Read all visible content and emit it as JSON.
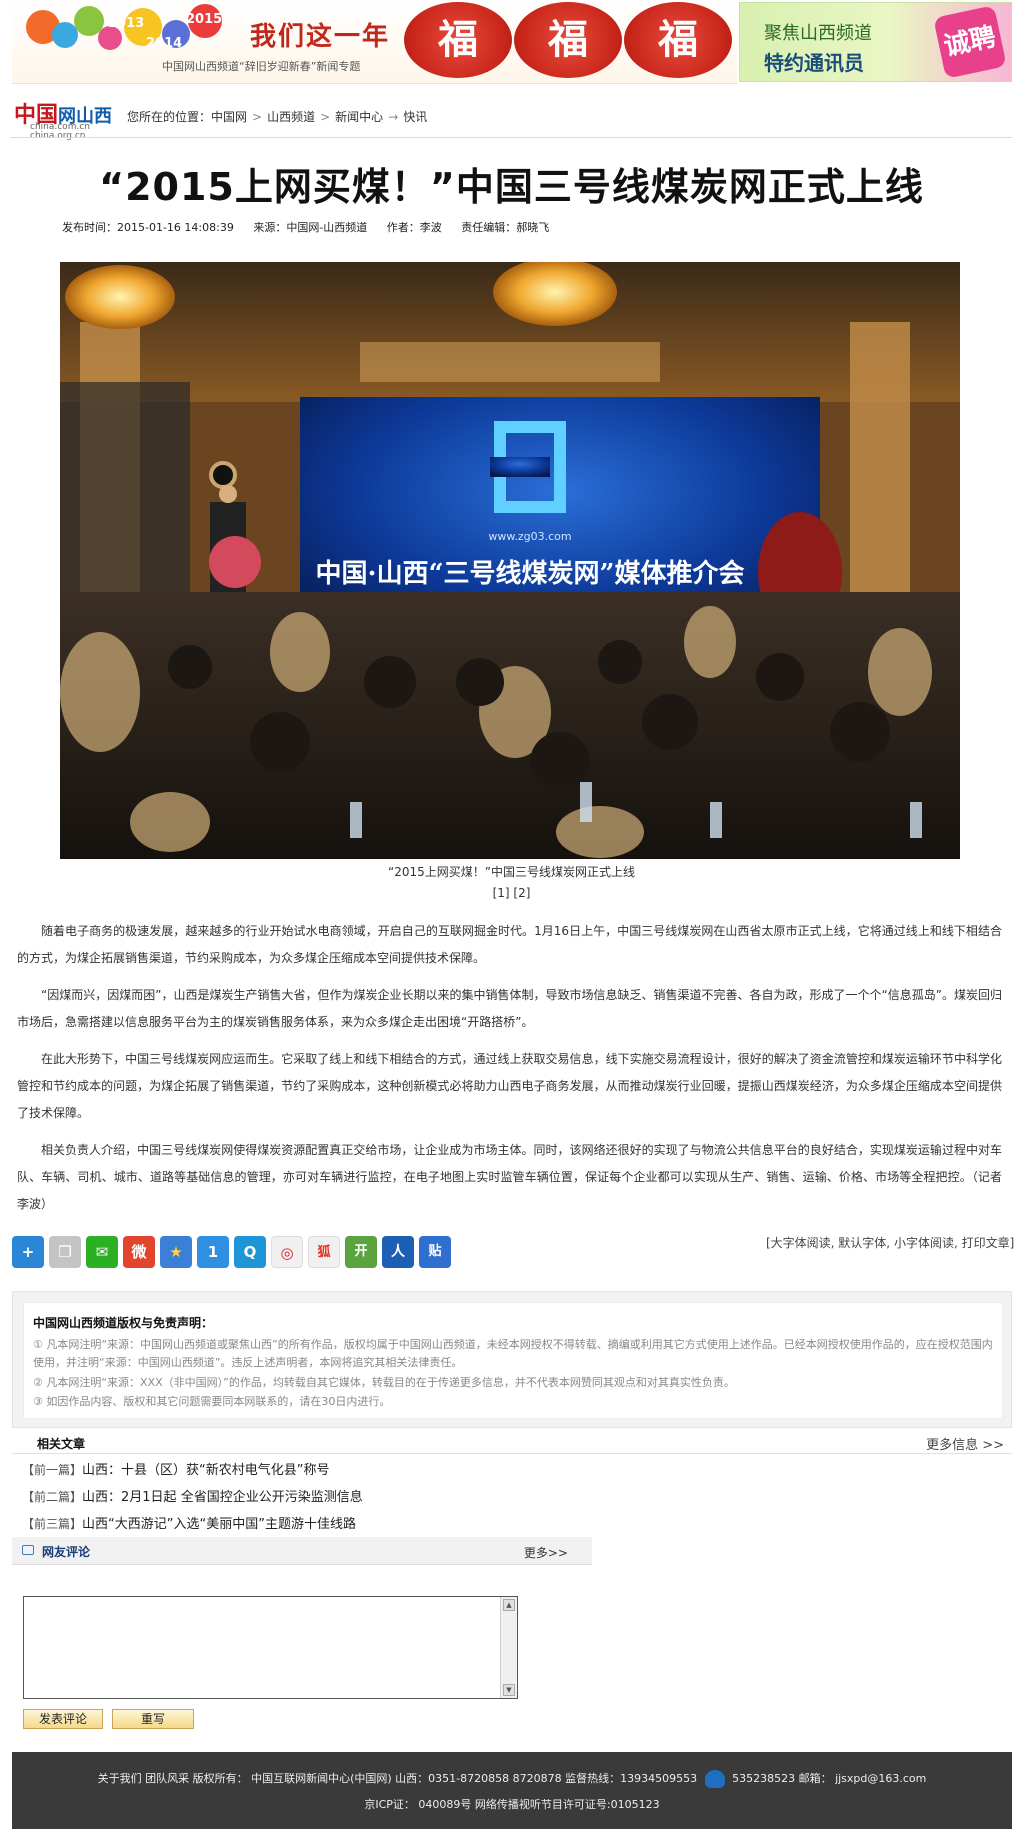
{
  "banner": {
    "years": [
      "2013",
      "2014",
      "2015"
    ],
    "title": "我们这一年",
    "caption": "中国网山西频道“辞旧岁迎新春”新闻专题",
    "fu_chars": [
      "福",
      "福",
      "福"
    ],
    "ad_line1": "聚焦山西频道",
    "ad_line2": "特约通讯员",
    "ad_badge": "诚聘"
  },
  "header": {
    "logo_main": "中国",
    "logo_accent": "网山西",
    "logo_sub1": "china.com.cn",
    "logo_sub2": "china.org.cn",
    "breadcrumb": {
      "prefix": "您所在的位置：",
      "items": [
        "中国网",
        "山西频道",
        "新闻中心",
        "快讯"
      ],
      "separators": [
        ">",
        ">",
        "→"
      ]
    }
  },
  "article": {
    "title": "“2015上网买煤！”中国三号线煤炭网正式上线",
    "meta": {
      "published": "发布时间：2015-01-16 14:08:39",
      "source": "来源：中国网-山西频道",
      "author": "作者：李波",
      "editor": "责任编辑：郝晓飞"
    },
    "photo": {
      "screen_number": "3",
      "screen_url": "www.zg03.com",
      "screen_headline": "中国·山西“三号线煤炭网”媒体推介会"
    },
    "caption": "“2015上网买煤！”中国三号线煤炭网正式上线",
    "pages": [
      "[1]",
      "[2]"
    ],
    "paragraphs": [
      "随着电子商务的极速发展，越来越多的行业开始试水电商领域，开启自己的互联网掘金时代。1月16日上午，中国三号线煤炭网在山西省太原市正式上线，它将通过线上和线下相结合的方式，为煤企拓展销售渠道，节约采购成本，为众多煤企压缩成本空间提供技术保障。",
      "“因煤而兴，因煤而困”，山西是煤炭生产销售大省，但作为煤炭企业长期以来的集中销售体制，导致市场信息缺乏、销售渠道不完善、各自为政，形成了一个个“信息孤岛”。煤炭回归市场后，急需搭建以信息服务平台为主的煤炭销售服务体系，来为众多煤企走出困境“开路搭桥”。",
      "在此大形势下，中国三号线煤炭网应运而生。它采取了线上和线下相结合的方式，通过线上获取交易信息，线下实施交易流程设计，很好的解决了资金流管控和煤炭运输环节中科学化管控和节约成本的问题，为煤企拓展了销售渠道，节约了采购成本，这种创新模式必将助力山西电子商务发展，从而推动煤炭行业回暖，提振山西煤炭经济，为众多煤企压缩成本空间提供了技术保障。",
      "相关负责人介绍，中国三号线煤炭网使得煤炭资源配置真正交给市场，让企业成为市场主体。同时，该网络还很好的实现了与物流公共信息平台的良好结合，实现煤炭运输过程中对车队、车辆、司机、城市、道路等基础信息的管理，亦可对车辆进行监控，在电子地图上实时监管车辆位置，保证每个企业都可以实现从生产、销售、运输、价格、市场等全程把控。（记者 李波）"
    ]
  },
  "share": {
    "buttons": [
      {
        "name": "share-more-icon",
        "glyph": "+",
        "color": "#2a86d6"
      },
      {
        "name": "share-copy-icon",
        "glyph": "❐",
        "color": "#b8b8b8"
      },
      {
        "name": "share-wechat-icon",
        "glyph": "✉",
        "color": "#2bb024"
      },
      {
        "name": "share-weibo-icon",
        "glyph": "微",
        "color": "#e2452b"
      },
      {
        "name": "share-favorite-icon",
        "glyph": "★",
        "color": "#3b7fd6"
      },
      {
        "name": "share-one-icon",
        "glyph": "1",
        "color": "#2f8fe0"
      },
      {
        "name": "share-qzone-icon",
        "glyph": "Q",
        "color": "#1d95d6"
      },
      {
        "name": "share-netease-icon",
        "glyph": "◎",
        "color": "#f0f0f0"
      },
      {
        "name": "share-sohu-icon",
        "glyph": "狐",
        "color": "#f0f0f0"
      },
      {
        "name": "share-kaixin-icon",
        "glyph": "开",
        "color": "#5aa33e"
      },
      {
        "name": "share-renren-icon",
        "glyph": "人",
        "color": "#1d5fb5"
      },
      {
        "name": "share-tieba-icon",
        "glyph": "贴",
        "color": "#2f6fd0"
      }
    ],
    "font_links": "[大字体阅读, 默认字体, 小字体阅读, 打印文章]"
  },
  "copyright": {
    "title": "中国网山西频道版权与免责声明：",
    "items": [
      "① 凡本网注明“来源：中国网山西频道或聚焦山西”的所有作品，版权均属于中国网山西频道，未经本网授权不得转载、摘编或利用其它方式使用上述作品。已经本网授权使用作品的，应在授权范围内使用，并注明“来源：中国网山西频道”。违反上述声明者，本网将追究其相关法律责任。",
      "② 凡本网注明“来源：XXX（非中国网）”的作品，均转载自其它媒体，转载目的在于传递更多信息，并不代表本网赞同其观点和对其真实性负责。",
      "③ 如因作品内容、版权和其它问题需要同本网联系的，请在30日内进行。"
    ]
  },
  "related": {
    "title": "相关文章",
    "more": "更多信息 >>",
    "items": [
      {
        "tag": "【前一篇】",
        "text": "山西：十县（区）获“新农村电气化县”称号"
      },
      {
        "tag": "【前二篇】",
        "text": "山西：2月1日起 全省国控企业公开污染监测信息"
      },
      {
        "tag": "【前三篇】",
        "text": "山西“大西游记”入选“美丽中国”主题游十佳线路"
      }
    ]
  },
  "comments": {
    "title": "网友评论",
    "more": "更多>>",
    "submit": "发表评论",
    "reset": "重写"
  },
  "footer": {
    "line1": "关于我们 团队风采 版权所有： 中国互联网新闻中心(中国网)  山西：0351-8720858 8720878 监督热线：13934509553",
    "qq": "535238523 邮箱： jjsxpd@163.com",
    "line2": "京ICP证： 040089号 网络传播视听节目许可证号:0105123"
  }
}
